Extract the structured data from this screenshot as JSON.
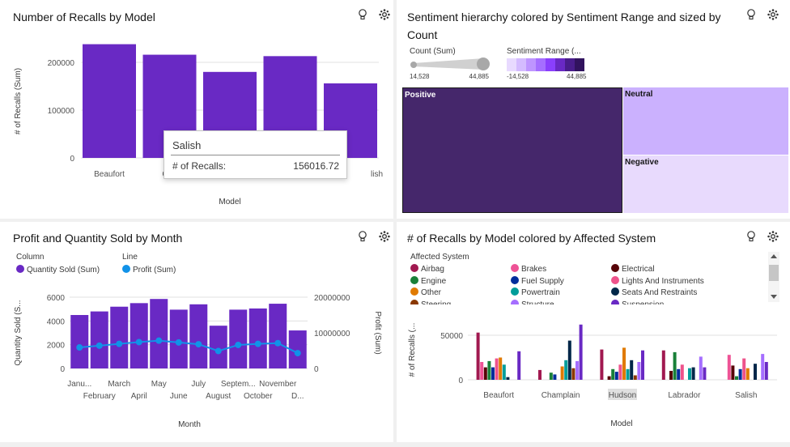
{
  "panels": {
    "recalls": {
      "title": "Number of Recalls by Model",
      "tooltip": {
        "title": "Salish",
        "label": "# of Recalls:",
        "value": "156016.72"
      }
    },
    "sentiment": {
      "title_line1": "Sentiment hierarchy colored by Sentiment Range and sized by",
      "title_line2": "Count",
      "count_legend": {
        "title": "Count (Sum)",
        "min": "14,528",
        "max": "44,885"
      },
      "range_legend": {
        "title": "Sentiment Range (...",
        "min": "-14,528",
        "max": "44,885",
        "colors": [
          "#e8daff",
          "#d4bbff",
          "#be95ff",
          "#a56eff",
          "#8a3ffc",
          "#6929c4",
          "#491d8b",
          "#31135e"
        ]
      },
      "nodes": [
        {
          "label": "Positive",
          "color": "#45276b"
        },
        {
          "label": "Neutral",
          "color": "#cbb1fe"
        },
        {
          "label": "Negative",
          "color": "#e8dafd"
        }
      ]
    },
    "profit": {
      "title": "Profit and Quantity Sold by Month",
      "legend": {
        "column_title": "Column",
        "column_item": "Quantity Sold (Sum)",
        "line_title": "Line",
        "line_item": "Profit (Sum)"
      }
    },
    "affected": {
      "title": "# of Recalls by Model colored by Affected System",
      "legend_title": "Affected System",
      "systems": [
        {
          "name": "Airbag",
          "color": "#a11950"
        },
        {
          "name": "Brakes",
          "color": "#ee5396"
        },
        {
          "name": "Electrical",
          "color": "#570408"
        },
        {
          "name": "Engine",
          "color": "#198038"
        },
        {
          "name": "Fuel Supply",
          "color": "#002d9c"
        },
        {
          "name": "Lights And Instruments",
          "color": "#ee538b"
        },
        {
          "name": "Other",
          "color": "#e07a00"
        },
        {
          "name": "Powertrain",
          "color": "#009d9a"
        },
        {
          "name": "Seats And Restraints",
          "color": "#012749"
        },
        {
          "name": "Steering",
          "color": "#8a3800"
        },
        {
          "name": "Structure",
          "color": "#a56eff"
        },
        {
          "name": "Suspension",
          "color": "#6929c4"
        }
      ]
    }
  },
  "icons": {
    "bulb": "lightbulb-icon",
    "settings": "gear-icon"
  },
  "chart_data": [
    {
      "type": "bar",
      "categories": [
        "Beaufort",
        "Champlain",
        "Hudson",
        "Labrador",
        "Salish"
      ],
      "tick_labels": [
        "Beaufort",
        "Cha",
        "",
        "",
        "lish"
      ],
      "values": [
        238000,
        216000,
        180000,
        213000,
        156016.72
      ],
      "xlabel": "Model",
      "ylabel": "# of Recalls (Sum)",
      "yticks": [
        "0",
        "100000",
        "200000"
      ],
      "ylim": [
        0,
        270000
      ],
      "color": "#6929c4"
    },
    {
      "type": "bar",
      "categories": [
        "January",
        "February",
        "March",
        "April",
        "May",
        "June",
        "July",
        "August",
        "September",
        "October",
        "November",
        "December"
      ],
      "tick_labels": [
        "Janu...",
        "February",
        "March",
        "April",
        "May",
        "June",
        "July",
        "August",
        "Septem...",
        "October",
        "November",
        "D..."
      ],
      "series": [
        {
          "name": "Quantity Sold (Sum)",
          "type": "bar",
          "axis": "left",
          "color": "#6929c4",
          "values": [
            4500,
            4800,
            5200,
            5500,
            5850,
            4950,
            5400,
            3600,
            4950,
            5050,
            5450,
            3200
          ]
        },
        {
          "name": "Profit (Sum)",
          "type": "line",
          "axis": "right",
          "color": "#1192e8",
          "values": [
            5900000,
            6400000,
            6900000,
            7400000,
            7800000,
            7300000,
            6800000,
            4900000,
            6600000,
            6900000,
            7100000,
            4300000
          ]
        }
      ],
      "xlabel": "Month",
      "ylabel_left": "Quantity Sold (S...",
      "ylabel_right": "Profit (Sum)",
      "yticks_left": [
        "0",
        "2000",
        "4000",
        "6000"
      ],
      "ylim_left": [
        0,
        6000
      ],
      "yticks_right": [
        "0",
        "10000000",
        "20000000"
      ],
      "ylim_right": [
        0,
        20000000
      ]
    },
    {
      "type": "bar",
      "categories": [
        "Beaufort",
        "Champlain",
        "Hudson",
        "Labrador",
        "Salish"
      ],
      "systems": [
        "Airbag",
        "Brakes",
        "Electrical",
        "Engine",
        "Fuel Supply",
        "Lights And Instruments",
        "Other",
        "Powertrain",
        "Seats And Restraints",
        "Steering",
        "Structure",
        "Suspension"
      ],
      "values": [
        [
          53000,
          20000,
          14000,
          21000,
          14000,
          24000,
          25000,
          17000,
          3000,
          0,
          0,
          32000
        ],
        [
          11000,
          0,
          0,
          8000,
          6000,
          0,
          15000,
          22000,
          44000,
          13000,
          21000,
          62000
        ],
        [
          34000,
          0,
          4000,
          12000,
          9000,
          17000,
          36000,
          12000,
          22000,
          5000,
          20000,
          33000
        ],
        [
          33000,
          0,
          10000,
          31000,
          12000,
          17000,
          0,
          13000,
          14000,
          0,
          26000,
          14000
        ],
        [
          0,
          28000,
          16000,
          4000,
          12000,
          24000,
          13000,
          0,
          18000,
          0,
          29000,
          20000
        ]
      ],
      "xlabel": "Model",
      "ylabel": "# of Recalls (...",
      "yticks": [
        "0",
        "50000"
      ],
      "ylim": [
        0,
        70000
      ],
      "highlight": "Hudson"
    }
  ]
}
